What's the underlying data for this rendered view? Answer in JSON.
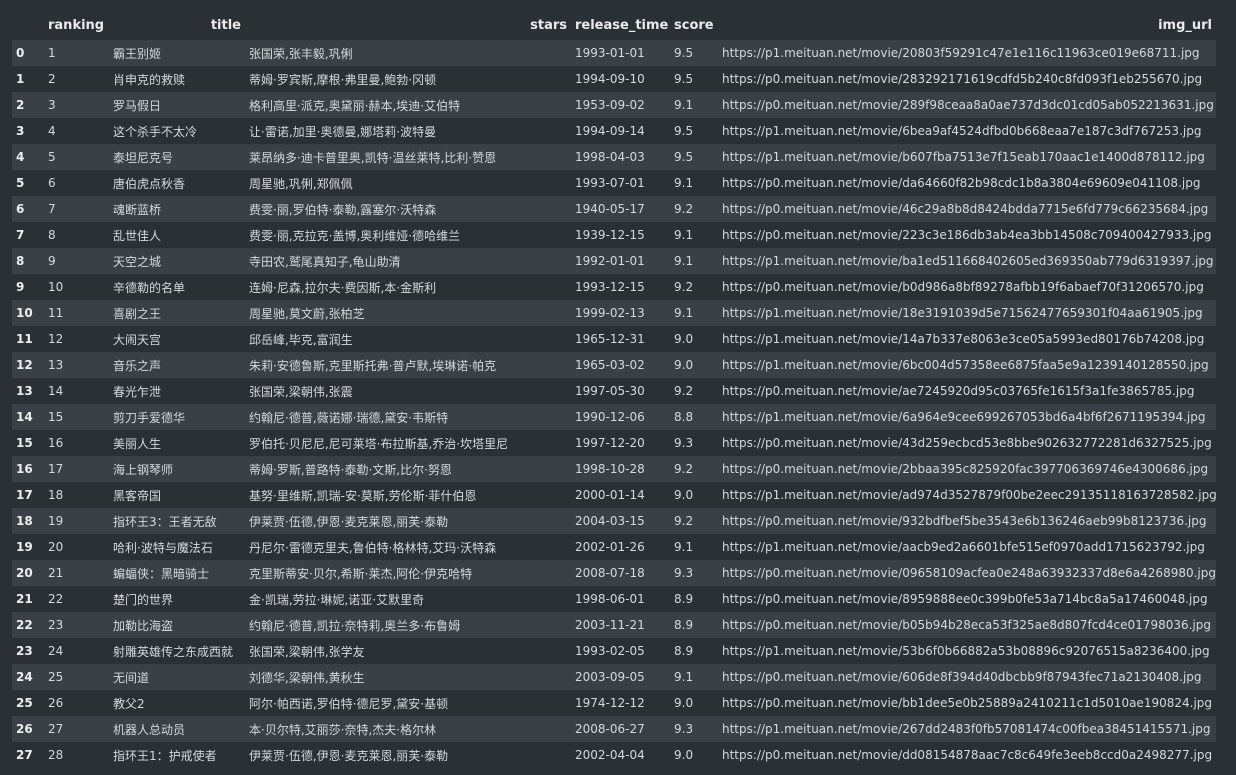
{
  "table": {
    "columns": [
      "",
      "ranking",
      "title",
      "stars",
      "release_time",
      "score",
      "img_url"
    ],
    "rows": [
      {
        "index": "0",
        "ranking": "1",
        "title": "霸王别姬",
        "stars": "张国荣,张丰毅,巩俐",
        "release_time": "1993-01-01",
        "score": "9.5",
        "img_url": "https://p1.meituan.net/movie/20803f59291c47e1e116c11963ce019e68711.jpg"
      },
      {
        "index": "1",
        "ranking": "2",
        "title": "肖申克的救赎",
        "stars": "蒂姆·罗宾斯,摩根·弗里曼,鲍勃·冈顿",
        "release_time": "1994-09-10",
        "score": "9.5",
        "img_url": "https://p0.meituan.net/movie/283292171619cdfd5b240c8fd093f1eb255670.jpg"
      },
      {
        "index": "2",
        "ranking": "3",
        "title": "罗马假日",
        "stars": "格利高里·派克,奥黛丽·赫本,埃迪·艾伯特",
        "release_time": "1953-09-02",
        "score": "9.1",
        "img_url": "https://p0.meituan.net/movie/289f98ceaa8a0ae737d3dc01cd05ab052213631.jpg"
      },
      {
        "index": "3",
        "ranking": "4",
        "title": "这个杀手不太冷",
        "stars": "让·雷诺,加里·奥德曼,娜塔莉·波特曼",
        "release_time": "1994-09-14",
        "score": "9.5",
        "img_url": "https://p1.meituan.net/movie/6bea9af4524dfbd0b668eaa7e187c3df767253.jpg"
      },
      {
        "index": "4",
        "ranking": "5",
        "title": "泰坦尼克号",
        "stars": "莱昂纳多·迪卡普里奥,凯特·温丝莱特,比利·赞恩",
        "release_time": "1998-04-03",
        "score": "9.5",
        "img_url": "https://p1.meituan.net/movie/b607fba7513e7f15eab170aac1e1400d878112.jpg"
      },
      {
        "index": "5",
        "ranking": "6",
        "title": "唐伯虎点秋香",
        "stars": "周星驰,巩俐,郑佩佩",
        "release_time": "1993-07-01",
        "score": "9.1",
        "img_url": "https://p0.meituan.net/movie/da64660f82b98cdc1b8a3804e69609e041108.jpg"
      },
      {
        "index": "6",
        "ranking": "7",
        "title": "魂断蓝桥",
        "stars": "费雯·丽,罗伯特·泰勒,露塞尔·沃特森",
        "release_time": "1940-05-17",
        "score": "9.2",
        "img_url": "https://p0.meituan.net/movie/46c29a8b8d8424bdda7715e6fd779c66235684.jpg"
      },
      {
        "index": "7",
        "ranking": "8",
        "title": "乱世佳人",
        "stars": "费雯·丽,克拉克·盖博,奥利维娅·德哈维兰",
        "release_time": "1939-12-15",
        "score": "9.1",
        "img_url": "https://p0.meituan.net/movie/223c3e186db3ab4ea3bb14508c709400427933.jpg"
      },
      {
        "index": "8",
        "ranking": "9",
        "title": "天空之城",
        "stars": "寺田农,鹫尾真知子,龟山助清",
        "release_time": "1992-01-01",
        "score": "9.1",
        "img_url": "https://p1.meituan.net/movie/ba1ed511668402605ed369350ab779d6319397.jpg"
      },
      {
        "index": "9",
        "ranking": "10",
        "title": "辛德勒的名单",
        "stars": "连姆·尼森,拉尔夫·费因斯,本·金斯利",
        "release_time": "1993-12-15",
        "score": "9.2",
        "img_url": "https://p0.meituan.net/movie/b0d986a8bf89278afbb19f6abaef70f31206570.jpg"
      },
      {
        "index": "10",
        "ranking": "11",
        "title": "喜剧之王",
        "stars": "周星驰,莫文蔚,张柏芝",
        "release_time": "1999-02-13",
        "score": "9.1",
        "img_url": "https://p1.meituan.net/movie/18e3191039d5e71562477659301f04aa61905.jpg"
      },
      {
        "index": "11",
        "ranking": "12",
        "title": "大闹天宫",
        "stars": "邱岳峰,毕克,富润生",
        "release_time": "1965-12-31",
        "score": "9.0",
        "img_url": "https://p1.meituan.net/movie/14a7b337e8063e3ce05a5993ed80176b74208.jpg"
      },
      {
        "index": "12",
        "ranking": "13",
        "title": "音乐之声",
        "stars": "朱莉·安德鲁斯,克里斯托弗·普卢默,埃琳诺·帕克",
        "release_time": "1965-03-02",
        "score": "9.0",
        "img_url": "https://p1.meituan.net/movie/6bc004d57358ee6875faa5e9a1239140128550.jpg"
      },
      {
        "index": "13",
        "ranking": "14",
        "title": "春光乍泄",
        "stars": "张国荣,梁朝伟,张震",
        "release_time": "1997-05-30",
        "score": "9.2",
        "img_url": "https://p0.meituan.net/movie/ae7245920d95c03765fe1615f3a1fe3865785.jpg"
      },
      {
        "index": "14",
        "ranking": "15",
        "title": "剪刀手爱德华",
        "stars": "约翰尼·德普,薇诺娜·瑞德,黛安·韦斯特",
        "release_time": "1990-12-06",
        "score": "8.8",
        "img_url": "https://p1.meituan.net/movie/6a964e9cee699267053bd6a4bf6f2671195394.jpg"
      },
      {
        "index": "15",
        "ranking": "16",
        "title": "美丽人生",
        "stars": "罗伯托·贝尼尼,尼可莱塔·布拉斯基,乔治·坎塔里尼",
        "release_time": "1997-12-20",
        "score": "9.3",
        "img_url": "https://p0.meituan.net/movie/43d259ecbcd53e8bbe902632772281d6327525.jpg"
      },
      {
        "index": "16",
        "ranking": "17",
        "title": "海上钢琴师",
        "stars": "蒂姆·罗斯,普路特·泰勒·文斯,比尔·努恩",
        "release_time": "1998-10-28",
        "score": "9.2",
        "img_url": "https://p0.meituan.net/movie/2bbaa395c825920fac397706369746e4300686.jpg"
      },
      {
        "index": "17",
        "ranking": "18",
        "title": "黑客帝国",
        "stars": "基努·里维斯,凯瑞-安·莫斯,劳伦斯·菲什伯恩",
        "release_time": "2000-01-14",
        "score": "9.0",
        "img_url": "https://p1.meituan.net/movie/ad974d3527879f00be2eec29135118163728582.jpg"
      },
      {
        "index": "18",
        "ranking": "19",
        "title": "指环王3：王者无敌",
        "stars": "伊莱贾·伍德,伊恩·麦克莱恩,丽芙·泰勒",
        "release_time": "2004-03-15",
        "score": "9.2",
        "img_url": "https://p0.meituan.net/movie/932bdfbef5be3543e6b136246aeb99b8123736.jpg"
      },
      {
        "index": "19",
        "ranking": "20",
        "title": "哈利·波特与魔法石",
        "stars": "丹尼尔·雷德克里夫,鲁伯特·格林特,艾玛·沃特森",
        "release_time": "2002-01-26",
        "score": "9.1",
        "img_url": "https://p1.meituan.net/movie/aacb9ed2a6601bfe515ef0970add1715623792.jpg"
      },
      {
        "index": "20",
        "ranking": "21",
        "title": "蝙蝠侠：黑暗骑士",
        "stars": "克里斯蒂安·贝尔,希斯·莱杰,阿伦·伊克哈特",
        "release_time": "2008-07-18",
        "score": "9.3",
        "img_url": "https://p0.meituan.net/movie/09658109acfea0e248a63932337d8e6a4268980.jpg"
      },
      {
        "index": "21",
        "ranking": "22",
        "title": "楚门的世界",
        "stars": "金·凯瑞,劳拉·琳妮,诺亚·艾默里奇",
        "release_time": "1998-06-01",
        "score": "8.9",
        "img_url": "https://p0.meituan.net/movie/8959888ee0c399b0fe53a714bc8a5a17460048.jpg"
      },
      {
        "index": "22",
        "ranking": "23",
        "title": "加勒比海盗",
        "stars": "约翰尼·德普,凯拉·奈特莉,奥兰多·布鲁姆",
        "release_time": "2003-11-21",
        "score": "8.9",
        "img_url": "https://p0.meituan.net/movie/b05b94b28eca53f325ae8d807fcd4ce01798036.jpg"
      },
      {
        "index": "23",
        "ranking": "24",
        "title": "射雕英雄传之东成西就",
        "stars": "张国荣,梁朝伟,张学友",
        "release_time": "1993-02-05",
        "score": "8.9",
        "img_url": "https://p1.meituan.net/movie/53b6f0b66882a53b08896c92076515a8236400.jpg"
      },
      {
        "index": "24",
        "ranking": "25",
        "title": "无间道",
        "stars": "刘德华,梁朝伟,黄秋生",
        "release_time": "2003-09-05",
        "score": "9.1",
        "img_url": "https://p0.meituan.net/movie/606de8f394d40dbcbb9f87943fec71a2130408.jpg"
      },
      {
        "index": "25",
        "ranking": "26",
        "title": "教父2",
        "stars": "阿尔·帕西诺,罗伯特·德尼罗,黛安·基顿",
        "release_time": "1974-12-12",
        "score": "9.0",
        "img_url": "https://p0.meituan.net/movie/bb1dee5e0b25889a2410211c1d5010ae190824.jpg"
      },
      {
        "index": "26",
        "ranking": "27",
        "title": "机器人总动员",
        "stars": "本·贝尔特,艾丽莎·奈特,杰夫·格尔林",
        "release_time": "2008-06-27",
        "score": "9.3",
        "img_url": "https://p1.meituan.net/movie/267dd2483f0fb57081474c00fbea38451415571.jpg"
      },
      {
        "index": "27",
        "ranking": "28",
        "title": "指环王1：护戒使者",
        "stars": "伊莱贾·伍德,伊恩·麦克莱恩,丽芙·泰勒",
        "release_time": "2002-04-04",
        "score": "9.0",
        "img_url": "https://p0.meituan.net/movie/dd08154878aac7c8c649fe3eeb8ccd0a2498277.jpg"
      }
    ]
  },
  "colors": {
    "background": "#2b3035",
    "stripe": "#3a4046",
    "text": "#d6d9dc",
    "header_text": "#e9ebed"
  }
}
